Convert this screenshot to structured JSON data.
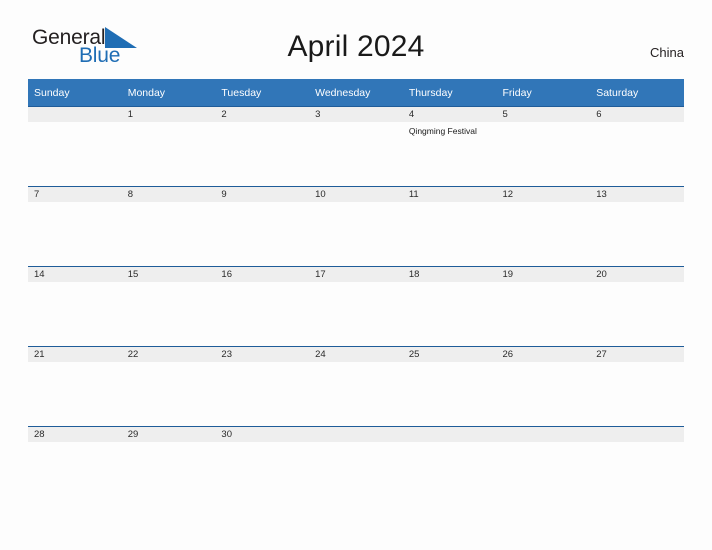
{
  "brand": {
    "name_part1": "General",
    "name_part2": "Blue",
    "triangle_icon": "triangle-icon",
    "accent_color": "#1f6db4"
  },
  "header": {
    "title": "April 2024",
    "country": "China"
  },
  "calendar": {
    "month": "April",
    "year": "2024",
    "header_bg": "#3176b8",
    "daynum_band_bg": "#eeeeee",
    "daynum_band_border": "#1f5c99",
    "weekday_headers": [
      "Sunday",
      "Monday",
      "Tuesday",
      "Wednesday",
      "Thursday",
      "Friday",
      "Saturday"
    ],
    "weeks": [
      [
        {
          "day": "",
          "events": []
        },
        {
          "day": "1",
          "events": []
        },
        {
          "day": "2",
          "events": []
        },
        {
          "day": "3",
          "events": []
        },
        {
          "day": "4",
          "events": [
            "Qingming Festival"
          ]
        },
        {
          "day": "5",
          "events": []
        },
        {
          "day": "6",
          "events": []
        }
      ],
      [
        {
          "day": "7",
          "events": []
        },
        {
          "day": "8",
          "events": []
        },
        {
          "day": "9",
          "events": []
        },
        {
          "day": "10",
          "events": []
        },
        {
          "day": "11",
          "events": []
        },
        {
          "day": "12",
          "events": []
        },
        {
          "day": "13",
          "events": []
        }
      ],
      [
        {
          "day": "14",
          "events": []
        },
        {
          "day": "15",
          "events": []
        },
        {
          "day": "16",
          "events": []
        },
        {
          "day": "17",
          "events": []
        },
        {
          "day": "18",
          "events": []
        },
        {
          "day": "19",
          "events": []
        },
        {
          "day": "20",
          "events": []
        }
      ],
      [
        {
          "day": "21",
          "events": []
        },
        {
          "day": "22",
          "events": []
        },
        {
          "day": "23",
          "events": []
        },
        {
          "day": "24",
          "events": []
        },
        {
          "day": "25",
          "events": []
        },
        {
          "day": "26",
          "events": []
        },
        {
          "day": "27",
          "events": []
        }
      ],
      [
        {
          "day": "28",
          "events": []
        },
        {
          "day": "29",
          "events": []
        },
        {
          "day": "30",
          "events": []
        },
        {
          "day": "",
          "events": []
        },
        {
          "day": "",
          "events": []
        },
        {
          "day": "",
          "events": []
        },
        {
          "day": "",
          "events": []
        }
      ]
    ]
  }
}
